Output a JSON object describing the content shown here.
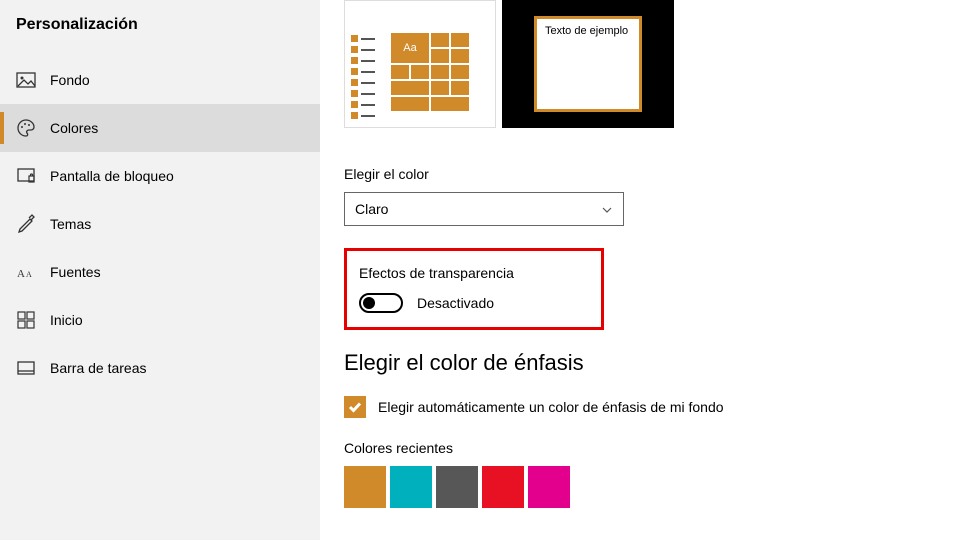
{
  "sidebar": {
    "title": "Personalización",
    "items": [
      {
        "label": "Fondo",
        "icon": "picture-icon"
      },
      {
        "label": "Colores",
        "icon": "palette-icon"
      },
      {
        "label": "Pantalla de bloqueo",
        "icon": "lock-screen-icon"
      },
      {
        "label": "Temas",
        "icon": "themes-icon"
      },
      {
        "label": "Fuentes",
        "icon": "fonts-icon"
      },
      {
        "label": "Inicio",
        "icon": "start-icon"
      },
      {
        "label": "Barra de tareas",
        "icon": "taskbar-icon"
      }
    ],
    "selected_index": 1
  },
  "preview": {
    "tile_label": "Aa",
    "window_text": "Texto de ejemplo"
  },
  "accent_color": "#d18a2a",
  "choose_color": {
    "label": "Elegir el color",
    "value": "Claro"
  },
  "transparency": {
    "label": "Efectos de transparencia",
    "state": "Desactivado",
    "on": false
  },
  "accent": {
    "heading": "Elegir el color de énfasis",
    "auto_label": "Elegir automáticamente un color de énfasis de mi fondo",
    "auto_checked": true
  },
  "recent_colors": {
    "label": "Colores recientes",
    "colors": [
      "#d18a2a",
      "#00b0bd",
      "#575757",
      "#e81123",
      "#e3008c"
    ]
  }
}
